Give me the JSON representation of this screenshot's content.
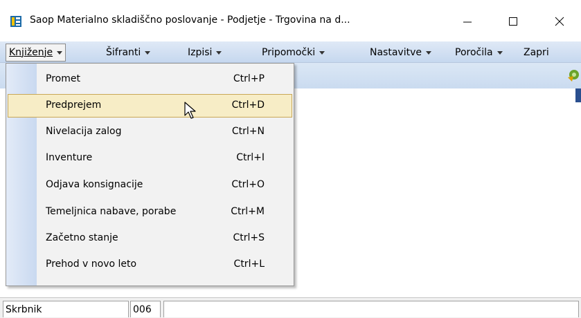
{
  "window": {
    "title": "Saop  Materialno skladiščno poslovanje - Podjetje - Trgovina na d...",
    "minimize_label": "—",
    "maximize_label": "☐",
    "close_label": "✕"
  },
  "menubar": {
    "items": [
      {
        "label": "Knjiženje",
        "mnemonic": "K"
      },
      {
        "label": "Šifranti",
        "mnemonic": "f"
      },
      {
        "label": "Izpisi",
        "mnemonic": "I"
      },
      {
        "label": "Pripomočki",
        "mnemonic": "P"
      },
      {
        "label": "Nastavitve",
        "mnemonic": "N"
      },
      {
        "label": "Poročila",
        "mnemonic": ""
      },
      {
        "label": "Zapri",
        "mnemonic": "Z"
      }
    ]
  },
  "dropdown": {
    "items": [
      {
        "label": "Promet",
        "shortcut": "Ctrl+P"
      },
      {
        "label": "Predprejem",
        "shortcut": "Ctrl+D"
      },
      {
        "label": "Nivelacija zalog",
        "shortcut": "Ctrl+N"
      },
      {
        "label": "Inventure",
        "shortcut": "Ctrl+I"
      },
      {
        "label": "Odjava konsignacije",
        "shortcut": "Ctrl+O"
      },
      {
        "label": "Temeljnica nabave, porabe",
        "shortcut": "Ctrl+M"
      },
      {
        "label": "Začetno stanje",
        "shortcut": "Ctrl+S"
      },
      {
        "label": "Prehod v novo leto",
        "shortcut": "Ctrl+L"
      }
    ],
    "hovered_index": 1
  },
  "statusbar": {
    "user": "Skrbnik",
    "code": "006",
    "message": ""
  },
  "colors": {
    "menubar": "#cfdff2",
    "hover_fill": "#f7edc6",
    "hover_border": "#c8a756"
  }
}
